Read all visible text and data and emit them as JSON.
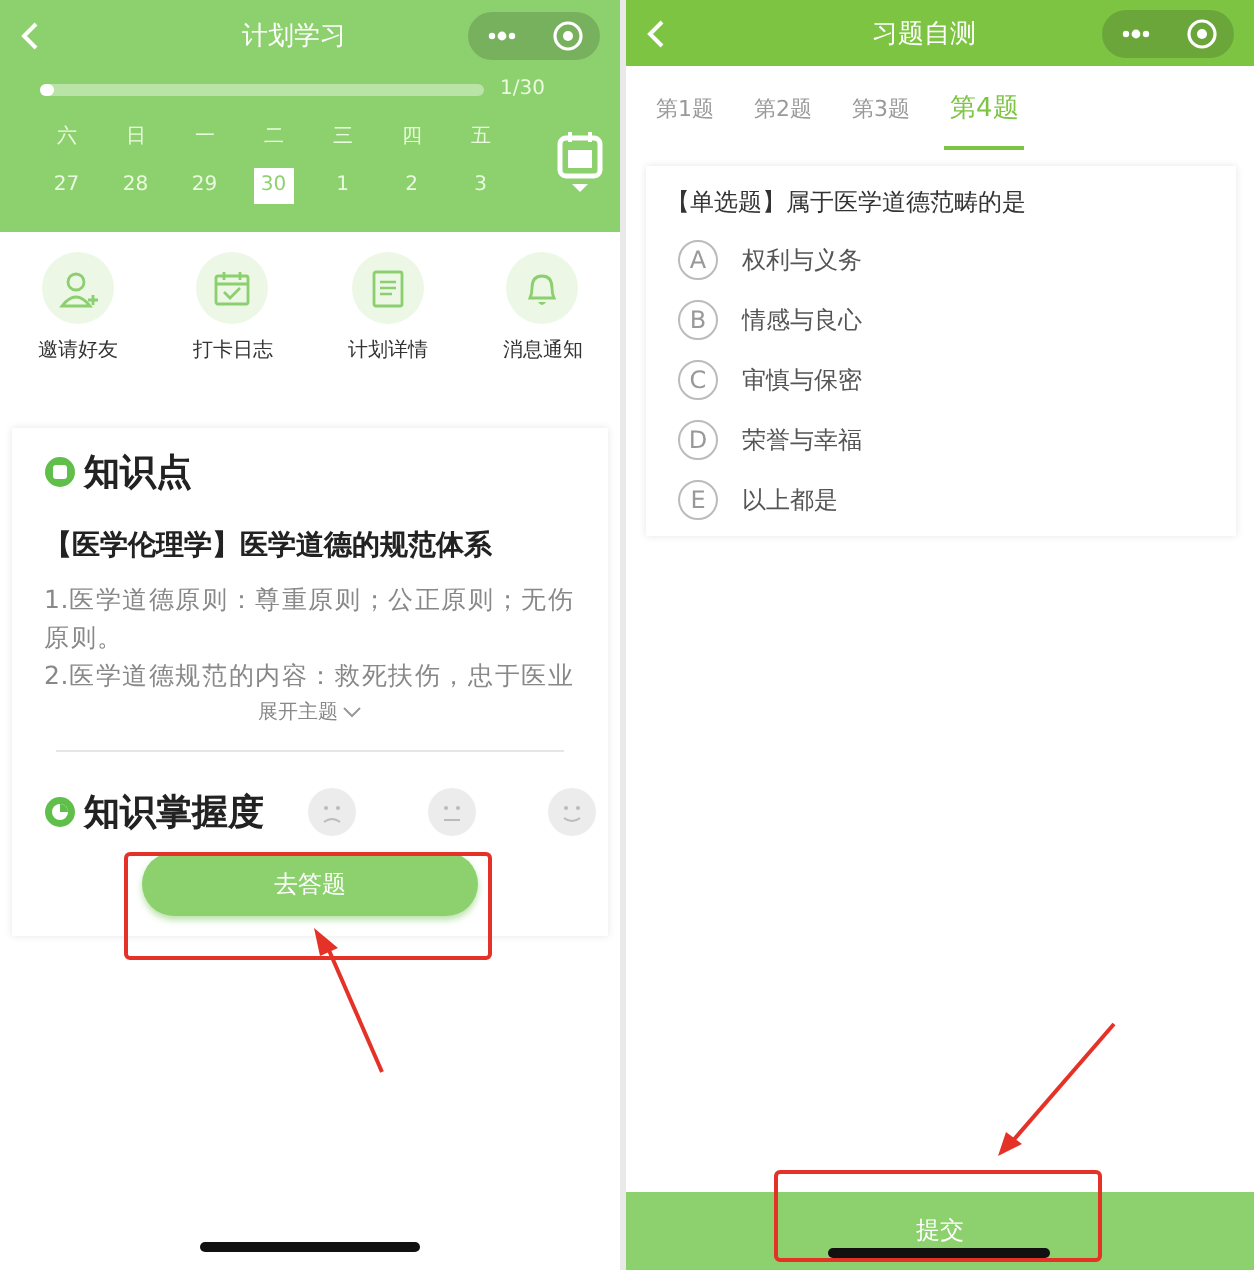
{
  "plan_screen": {
    "title": "计划学习",
    "progress": {
      "level": 0.03,
      "reading": "1/30"
    },
    "week": [
      {
        "weekday": "六",
        "date": "27",
        "selected": false
      },
      {
        "weekday": "日",
        "date": "28",
        "selected": false
      },
      {
        "weekday": "一",
        "date": "29",
        "selected": false
      },
      {
        "weekday": "二",
        "date": "30",
        "selected": true
      },
      {
        "weekday": "三",
        "date": "1",
        "selected": false
      },
      {
        "weekday": "四",
        "date": "2",
        "selected": false
      },
      {
        "weekday": "五",
        "date": "3",
        "selected": false
      }
    ],
    "actions": [
      {
        "kind": "invite",
        "label": "邀请好友"
      },
      {
        "kind": "checkin",
        "label": "打卡日志"
      },
      {
        "kind": "details",
        "label": "计划详情"
      },
      {
        "kind": "notify",
        "label": "消息通知"
      }
    ],
    "knowledge": {
      "heading": "知识点",
      "title": "【医学伦理学】医学道德的规范体系",
      "body": [
        "1.医学道德原则：尊重原则；公正原则；无伤原则。",
        "2.医学道德规范的内容：救死扶伤，忠于医业"
      ],
      "expand": "展开主题"
    },
    "mastery": {
      "heading": "知识掌握度"
    },
    "answer_button": {
      "label": "去答题",
      "highlighted": true
    }
  },
  "quiz_screen": {
    "title": "习题自测",
    "tabs": [
      {
        "label": "第1题",
        "selected": false
      },
      {
        "label": "第2题",
        "selected": false
      },
      {
        "label": "第3题",
        "selected": false
      },
      {
        "label": "第4题",
        "selected": true
      }
    ],
    "question": "【单选题】属于医学道德范畴的是",
    "options": [
      {
        "letter": "A",
        "text": "权利与义务"
      },
      {
        "letter": "B",
        "text": "情感与良心"
      },
      {
        "letter": "C",
        "text": "审慎与保密"
      },
      {
        "letter": "D",
        "text": "荣誉与幸福"
      },
      {
        "letter": "E",
        "text": "以上都是"
      }
    ],
    "submit_button": {
      "label": "提交",
      "highlighted": true
    }
  }
}
